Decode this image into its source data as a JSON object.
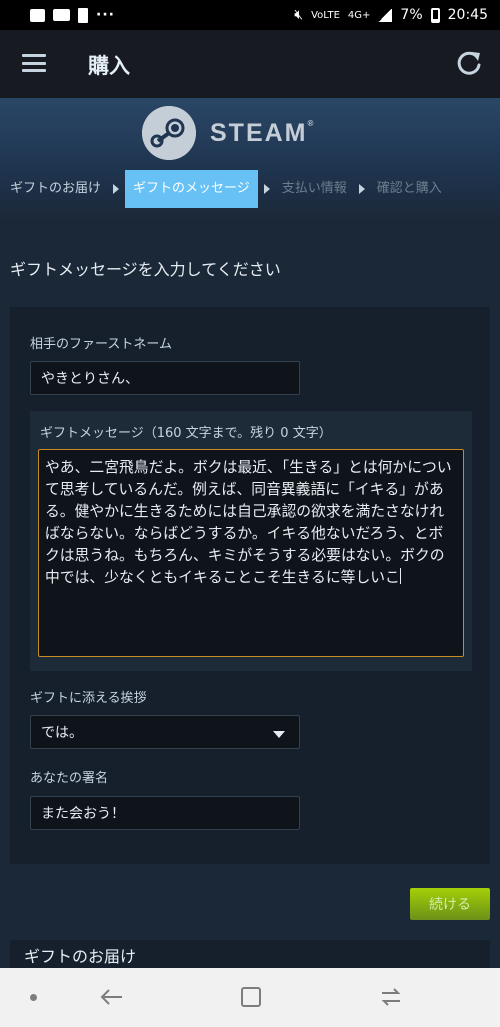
{
  "statusbar": {
    "network": "4G+",
    "network_small": "VoLTE",
    "battery": "7%",
    "time": "20:45",
    "more": "···"
  },
  "appbar": {
    "title": "購入"
  },
  "steam": {
    "wordmark": "STEAM"
  },
  "steps": [
    {
      "label": "ギフトのお届け",
      "state": "done"
    },
    {
      "label": "ギフトのメッセージ",
      "state": "active"
    },
    {
      "label": "支払い情報",
      "state": "todo"
    },
    {
      "label": "確認と購入",
      "state": "todo"
    }
  ],
  "form": {
    "heading": "ギフトメッセージを入力してください",
    "first_name_label": "相手のファーストネーム",
    "first_name_value": "やきとりさん、",
    "message_label": "ギフトメッセージ（160 文字まで。残り 0 文字）",
    "message_value": "やあ、二宮飛鳥だよ。ボクは最近、「生きる」とは何かについて思考しているんだ。例えば、同音異義語に「イキる」がある。健やかに生きるためには自己承認の欲求を満たさなければならない。ならばどうするか。イキる他ないだろう、とボクは思うね。もちろん、キミがそうする必要はない。ボクの中では、少なくともイキることこそ生きるに等しいこ",
    "greeting_label": "ギフトに添える挨拶",
    "greeting_value": "では。",
    "signature_label": "あなたの署名",
    "signature_value": "また会おう！",
    "continue_label": "続ける"
  },
  "delivery": {
    "heading": "ギフトのお届け"
  },
  "colors": {
    "background": "#1b2838",
    "active_step": "#67c1f5",
    "continue_button": "#a4d007",
    "focus_border": "#c98a1f"
  }
}
